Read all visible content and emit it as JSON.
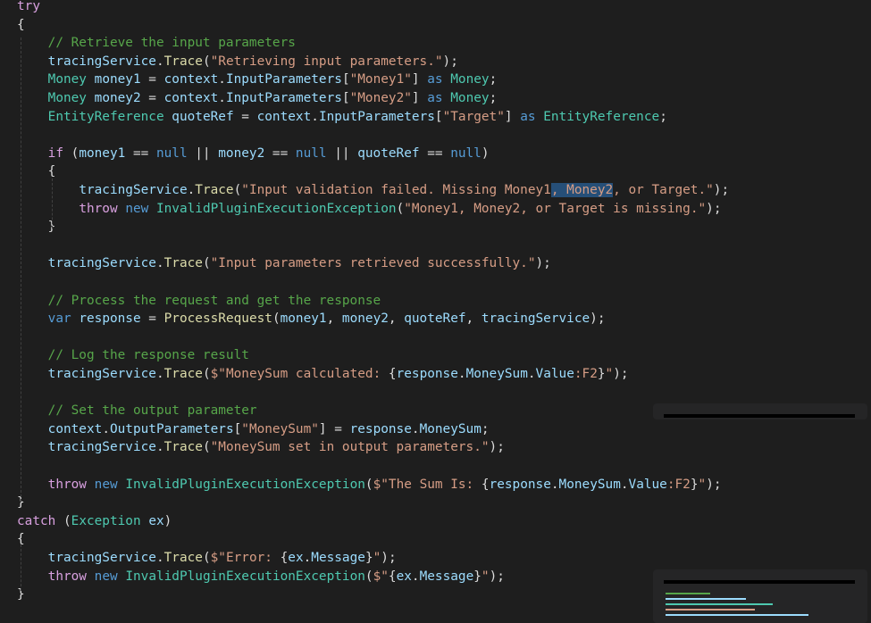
{
  "colors": {
    "background": "#1e1e1e",
    "keyword": "#569cd6",
    "control": "#d8a0df",
    "type": "#4ec9b0",
    "identifier": "#9cdcfe",
    "method": "#dcdcaa",
    "string": "#d69d85",
    "comment": "#57a64a",
    "text": "#dcdcdc",
    "selection": "#264f78"
  },
  "code_lines": [
    [
      {
        "t": "try",
        "c": "control"
      }
    ],
    [
      {
        "t": "{",
        "c": "text"
      }
    ],
    [
      {
        "t": "    // Retrieve the input parameters",
        "c": "comment"
      }
    ],
    [
      {
        "t": "    ",
        "c": "text"
      },
      {
        "t": "tracingService",
        "c": "identifier"
      },
      {
        "t": ".",
        "c": "text"
      },
      {
        "t": "Trace",
        "c": "method"
      },
      {
        "t": "(",
        "c": "text"
      },
      {
        "t": "\"Retrieving input parameters.\"",
        "c": "string"
      },
      {
        "t": ");",
        "c": "text"
      }
    ],
    [
      {
        "t": "    ",
        "c": "text"
      },
      {
        "t": "Money",
        "c": "type"
      },
      {
        "t": " ",
        "c": "text"
      },
      {
        "t": "money1",
        "c": "identifier"
      },
      {
        "t": " = ",
        "c": "text"
      },
      {
        "t": "context",
        "c": "identifier"
      },
      {
        "t": ".",
        "c": "text"
      },
      {
        "t": "InputParameters",
        "c": "identifier"
      },
      {
        "t": "[",
        "c": "text"
      },
      {
        "t": "\"Money1\"",
        "c": "string"
      },
      {
        "t": "] ",
        "c": "text"
      },
      {
        "t": "as",
        "c": "keyword"
      },
      {
        "t": " ",
        "c": "text"
      },
      {
        "t": "Money",
        "c": "type"
      },
      {
        "t": ";",
        "c": "text"
      }
    ],
    [
      {
        "t": "    ",
        "c": "text"
      },
      {
        "t": "Money",
        "c": "type"
      },
      {
        "t": " ",
        "c": "text"
      },
      {
        "t": "money2",
        "c": "identifier"
      },
      {
        "t": " = ",
        "c": "text"
      },
      {
        "t": "context",
        "c": "identifier"
      },
      {
        "t": ".",
        "c": "text"
      },
      {
        "t": "InputParameters",
        "c": "identifier"
      },
      {
        "t": "[",
        "c": "text"
      },
      {
        "t": "\"Money2\"",
        "c": "string"
      },
      {
        "t": "] ",
        "c": "text"
      },
      {
        "t": "as",
        "c": "keyword"
      },
      {
        "t": " ",
        "c": "text"
      },
      {
        "t": "Money",
        "c": "type"
      },
      {
        "t": ";",
        "c": "text"
      }
    ],
    [
      {
        "t": "    ",
        "c": "text"
      },
      {
        "t": "EntityReference",
        "c": "type"
      },
      {
        "t": " ",
        "c": "text"
      },
      {
        "t": "quoteRef",
        "c": "identifier"
      },
      {
        "t": " = ",
        "c": "text"
      },
      {
        "t": "context",
        "c": "identifier"
      },
      {
        "t": ".",
        "c": "text"
      },
      {
        "t": "InputParameters",
        "c": "identifier"
      },
      {
        "t": "[",
        "c": "text"
      },
      {
        "t": "\"Target\"",
        "c": "string"
      },
      {
        "t": "] ",
        "c": "text"
      },
      {
        "t": "as",
        "c": "keyword"
      },
      {
        "t": " ",
        "c": "text"
      },
      {
        "t": "EntityReference",
        "c": "type"
      },
      {
        "t": ";",
        "c": "text"
      }
    ],
    [],
    [
      {
        "t": "    ",
        "c": "text"
      },
      {
        "t": "if",
        "c": "control"
      },
      {
        "t": " (",
        "c": "text"
      },
      {
        "t": "money1",
        "c": "identifier"
      },
      {
        "t": " == ",
        "c": "text"
      },
      {
        "t": "null",
        "c": "keyword"
      },
      {
        "t": " || ",
        "c": "text"
      },
      {
        "t": "money2",
        "c": "identifier"
      },
      {
        "t": " == ",
        "c": "text"
      },
      {
        "t": "null",
        "c": "keyword"
      },
      {
        "t": " || ",
        "c": "text"
      },
      {
        "t": "quoteRef",
        "c": "identifier"
      },
      {
        "t": " == ",
        "c": "text"
      },
      {
        "t": "null",
        "c": "keyword"
      },
      {
        "t": ")",
        "c": "text"
      }
    ],
    [
      {
        "t": "    {",
        "c": "text"
      }
    ],
    [
      {
        "t": "        ",
        "c": "text"
      },
      {
        "t": "tracingService",
        "c": "identifier"
      },
      {
        "t": ".",
        "c": "text"
      },
      {
        "t": "Trace",
        "c": "method"
      },
      {
        "t": "(",
        "c": "text"
      },
      {
        "t": "\"Input validation failed. Missing Money1",
        "c": "string"
      },
      {
        "t": ", Money2",
        "c": "string",
        "sel": true
      },
      {
        "t": ", or Target.\"",
        "c": "string"
      },
      {
        "t": ");",
        "c": "text"
      }
    ],
    [
      {
        "t": "        ",
        "c": "text"
      },
      {
        "t": "throw",
        "c": "control"
      },
      {
        "t": " ",
        "c": "text"
      },
      {
        "t": "new",
        "c": "keyword"
      },
      {
        "t": " ",
        "c": "text"
      },
      {
        "t": "InvalidPluginExecutionException",
        "c": "type"
      },
      {
        "t": "(",
        "c": "text"
      },
      {
        "t": "\"Money1, Money2, or Target is missing.\"",
        "c": "string"
      },
      {
        "t": ");",
        "c": "text"
      }
    ],
    [
      {
        "t": "    }",
        "c": "text"
      }
    ],
    [],
    [
      {
        "t": "    ",
        "c": "text"
      },
      {
        "t": "tracingService",
        "c": "identifier"
      },
      {
        "t": ".",
        "c": "text"
      },
      {
        "t": "Trace",
        "c": "method"
      },
      {
        "t": "(",
        "c": "text"
      },
      {
        "t": "\"Input parameters retrieved successfully.\"",
        "c": "string"
      },
      {
        "t": ");",
        "c": "text"
      }
    ],
    [],
    [
      {
        "t": "    // Process the request and get the response",
        "c": "comment"
      }
    ],
    [
      {
        "t": "    ",
        "c": "text"
      },
      {
        "t": "var",
        "c": "keyword"
      },
      {
        "t": " ",
        "c": "text"
      },
      {
        "t": "response",
        "c": "identifier"
      },
      {
        "t": " = ",
        "c": "text"
      },
      {
        "t": "ProcessRequest",
        "c": "method"
      },
      {
        "t": "(",
        "c": "text"
      },
      {
        "t": "money1",
        "c": "identifier"
      },
      {
        "t": ", ",
        "c": "text"
      },
      {
        "t": "money2",
        "c": "identifier"
      },
      {
        "t": ", ",
        "c": "text"
      },
      {
        "t": "quoteRef",
        "c": "identifier"
      },
      {
        "t": ", ",
        "c": "text"
      },
      {
        "t": "tracingService",
        "c": "identifier"
      },
      {
        "t": ");",
        "c": "text"
      }
    ],
    [],
    [
      {
        "t": "    // Log the response result",
        "c": "comment"
      }
    ],
    [
      {
        "t": "    ",
        "c": "text"
      },
      {
        "t": "tracingService",
        "c": "identifier"
      },
      {
        "t": ".",
        "c": "text"
      },
      {
        "t": "Trace",
        "c": "method"
      },
      {
        "t": "(",
        "c": "text"
      },
      {
        "t": "$\"MoneySum calculated: ",
        "c": "string"
      },
      {
        "t": "{",
        "c": "text"
      },
      {
        "t": "response",
        "c": "identifier"
      },
      {
        "t": ".",
        "c": "text"
      },
      {
        "t": "MoneySum",
        "c": "identifier"
      },
      {
        "t": ".",
        "c": "text"
      },
      {
        "t": "Value",
        "c": "identifier"
      },
      {
        "t": ":F2",
        "c": "string"
      },
      {
        "t": "}",
        "c": "text"
      },
      {
        "t": "\"",
        "c": "string"
      },
      {
        "t": ");",
        "c": "text"
      }
    ],
    [],
    [
      {
        "t": "    // Set the output parameter",
        "c": "comment"
      }
    ],
    [
      {
        "t": "    ",
        "c": "text"
      },
      {
        "t": "context",
        "c": "identifier"
      },
      {
        "t": ".",
        "c": "text"
      },
      {
        "t": "OutputParameters",
        "c": "identifier"
      },
      {
        "t": "[",
        "c": "text"
      },
      {
        "t": "\"MoneySum\"",
        "c": "string"
      },
      {
        "t": "] = ",
        "c": "text"
      },
      {
        "t": "response",
        "c": "identifier"
      },
      {
        "t": ".",
        "c": "text"
      },
      {
        "t": "MoneySum",
        "c": "identifier"
      },
      {
        "t": ";",
        "c": "text"
      }
    ],
    [
      {
        "t": "    ",
        "c": "text"
      },
      {
        "t": "tracingService",
        "c": "identifier"
      },
      {
        "t": ".",
        "c": "text"
      },
      {
        "t": "Trace",
        "c": "method"
      },
      {
        "t": "(",
        "c": "text"
      },
      {
        "t": "\"MoneySum set in output parameters.\"",
        "c": "string"
      },
      {
        "t": ");",
        "c": "text"
      }
    ],
    [],
    [
      {
        "t": "    ",
        "c": "text"
      },
      {
        "t": "throw",
        "c": "control"
      },
      {
        "t": " ",
        "c": "text"
      },
      {
        "t": "new",
        "c": "keyword"
      },
      {
        "t": " ",
        "c": "text"
      },
      {
        "t": "InvalidPluginExecutionException",
        "c": "type"
      },
      {
        "t": "(",
        "c": "text"
      },
      {
        "t": "$\"The Sum Is: ",
        "c": "string"
      },
      {
        "t": "{",
        "c": "text"
      },
      {
        "t": "response",
        "c": "identifier"
      },
      {
        "t": ".",
        "c": "text"
      },
      {
        "t": "MoneySum",
        "c": "identifier"
      },
      {
        "t": ".",
        "c": "text"
      },
      {
        "t": "Value",
        "c": "identifier"
      },
      {
        "t": ":F2",
        "c": "string"
      },
      {
        "t": "}",
        "c": "text"
      },
      {
        "t": "\"",
        "c": "string"
      },
      {
        "t": ");",
        "c": "text"
      }
    ],
    [
      {
        "t": "}",
        "c": "text"
      }
    ],
    [
      {
        "t": "catch",
        "c": "control"
      },
      {
        "t": " (",
        "c": "text"
      },
      {
        "t": "Exception",
        "c": "type"
      },
      {
        "t": " ",
        "c": "text"
      },
      {
        "t": "ex",
        "c": "identifier"
      },
      {
        "t": ")",
        "c": "text"
      }
    ],
    [
      {
        "t": "{",
        "c": "text"
      }
    ],
    [
      {
        "t": "    ",
        "c": "text"
      },
      {
        "t": "tracingService",
        "c": "identifier"
      },
      {
        "t": ".",
        "c": "text"
      },
      {
        "t": "Trace",
        "c": "method"
      },
      {
        "t": "(",
        "c": "text"
      },
      {
        "t": "$\"Error: ",
        "c": "string"
      },
      {
        "t": "{",
        "c": "text"
      },
      {
        "t": "ex",
        "c": "identifier"
      },
      {
        "t": ".",
        "c": "text"
      },
      {
        "t": "Message",
        "c": "identifier"
      },
      {
        "t": "}",
        "c": "text"
      },
      {
        "t": "\"",
        "c": "string"
      },
      {
        "t": ");",
        "c": "text"
      }
    ],
    [
      {
        "t": "    ",
        "c": "text"
      },
      {
        "t": "throw",
        "c": "control"
      },
      {
        "t": " ",
        "c": "text"
      },
      {
        "t": "new",
        "c": "keyword"
      },
      {
        "t": " ",
        "c": "text"
      },
      {
        "t": "InvalidPluginExecutionException",
        "c": "type"
      },
      {
        "t": "(",
        "c": "text"
      },
      {
        "t": "$\"",
        "c": "string"
      },
      {
        "t": "{",
        "c": "text"
      },
      {
        "t": "ex",
        "c": "identifier"
      },
      {
        "t": ".",
        "c": "text"
      },
      {
        "t": "Message",
        "c": "identifier"
      },
      {
        "t": "}",
        "c": "text"
      },
      {
        "t": "\"",
        "c": "string"
      },
      {
        "t": ");",
        "c": "text"
      }
    ],
    [
      {
        "t": "}",
        "c": "text"
      }
    ]
  ]
}
